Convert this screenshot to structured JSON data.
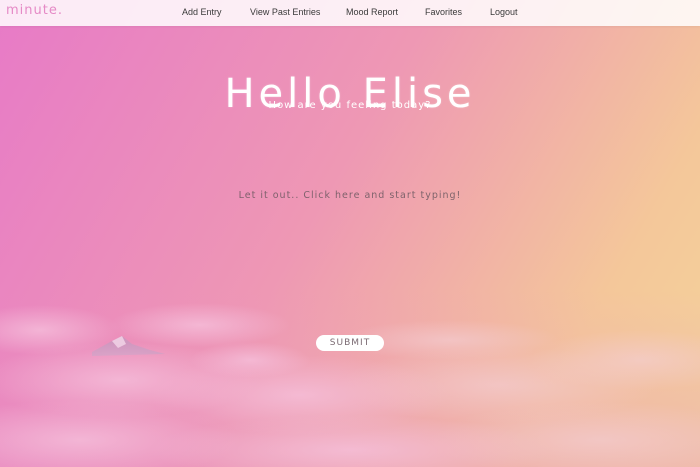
{
  "nav": {
    "brand": "minute.",
    "items": [
      {
        "label": "Add Entry"
      },
      {
        "label": "View Past Entries"
      },
      {
        "label": "Mood Report"
      },
      {
        "label": "Favorites"
      },
      {
        "label": "Logout"
      }
    ]
  },
  "main": {
    "greeting": "Hello Elise",
    "subtitle": "How are you feeling today?",
    "entry_placeholder": "Let it out.. Click here and start typing!",
    "entry_value": "",
    "submit_label": "SUBMIT"
  },
  "colors": {
    "brand": "#e58ac6",
    "gradient_left": "#e77ac7",
    "gradient_right": "#f4d49a"
  }
}
